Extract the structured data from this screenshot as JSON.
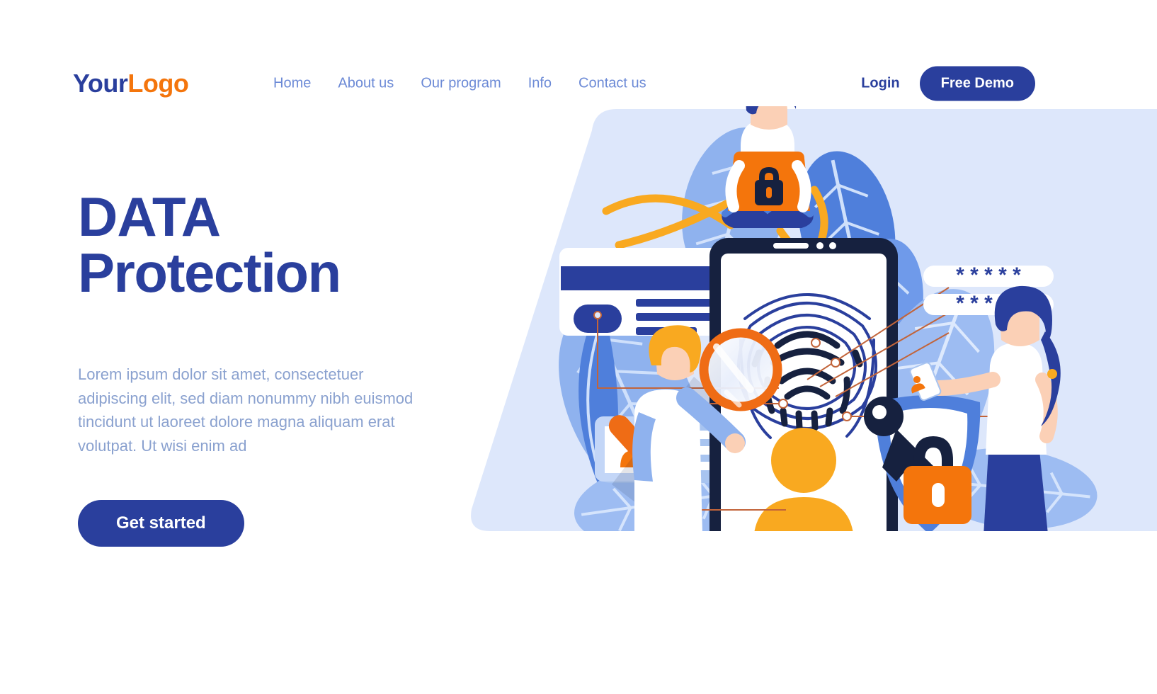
{
  "header": {
    "logo": {
      "part1": "Your",
      "part2": "Logo"
    },
    "nav": [
      {
        "label": "Home"
      },
      {
        "label": "About us"
      },
      {
        "label": "Our program"
      },
      {
        "label": "Info"
      },
      {
        "label": "Contact us"
      }
    ],
    "login_label": "Login",
    "demo_label": "Free Demo"
  },
  "hero": {
    "title_line1": "DATA",
    "title_line2": "Protection",
    "paragraph": "Lorem ipsum dolor sit amet, consectetuer adipiscing elit, sed diam nonummy nibh euismod tincidunt ut laoreet dolore magna aliquam erat volutpat. Ut wisi enim ad",
    "cta_label": "Get started"
  },
  "illustration": {
    "password_row1": "* * * * *",
    "password_row2": "* * * * *",
    "icons": [
      "laptop-lock-icon",
      "fingerprint-icon",
      "magnifier-icon",
      "shield-icon",
      "padlock-icon",
      "key-icon",
      "user-avatar-icon",
      "id-card-icon",
      "phone-icon"
    ]
  },
  "colors": {
    "brand_blue": "#2a3f9d",
    "brand_orange": "#f4750c",
    "nav_blue": "#6c8ad6",
    "body_text": "#8aa1cf",
    "bg_panel": "#dde7fb",
    "dark_navy": "#16213f",
    "leaf_blue": "#4f7fdb",
    "leaf_light": "#a8c4f0",
    "amber": "#f9a920"
  }
}
